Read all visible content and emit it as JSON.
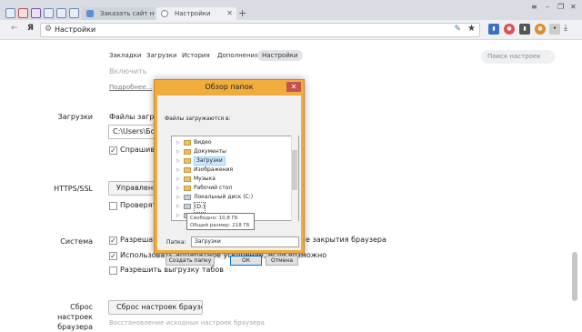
{
  "tabs": [
    {
      "label": "Заказать сайт недорого",
      "active": false
    },
    {
      "label": "Настройки",
      "active": true
    }
  ],
  "new_tab": "+",
  "window_controls": {
    "minimize": "–",
    "restore": "❐",
    "close": "✕"
  },
  "address_bar": {
    "brand": "Я",
    "url": "Настройки"
  },
  "settings_nav": [
    "Закладки",
    "Загрузки",
    "История",
    "Дополнения",
    "Настройки"
  ],
  "search_placeholder": "Поиск настроек",
  "settings": {
    "top_partial_text": "Включить",
    "more_link": "Подробнее...",
    "downloads": {
      "label": "Загрузки",
      "save_to": "Файлы загруж",
      "path": "C:\\Users\\Бос",
      "ask_checkbox": "Спрашиват"
    },
    "https": {
      "label": "HTTPS/SSL",
      "manage_button": "Управление",
      "check_checkbox": "Проверять"
    },
    "system": {
      "label": "Система",
      "item1": "Разрешать",
      "item1_tail": "е закрытия браузера",
      "item2": "Использовать аппаратное ускорение, если возможно",
      "item3": "Разрешить выгрузку табов"
    },
    "reset": {
      "label": "Сброс настроек браузера",
      "button": "Сброс настроек браузера",
      "faded": "Восстановление исходных настроек браузера"
    }
  },
  "dialog": {
    "title": "Обзор папок",
    "close": "✕",
    "caption": "Файлы загружаются в:",
    "tree": [
      {
        "name": "Видео",
        "type": "folder"
      },
      {
        "name": "Документы",
        "type": "folder"
      },
      {
        "name": "Загрузки",
        "type": "folder",
        "selected": true
      },
      {
        "name": "Изображения",
        "type": "folder"
      },
      {
        "name": "Музыка",
        "type": "folder"
      },
      {
        "name": "Рабочий стол",
        "type": "folder"
      },
      {
        "name": "Локальный диск (C:)",
        "type": "drive"
      },
      {
        "name": "(D:)",
        "type": "drive"
      },
      {
        "name": "",
        "type": "drive"
      }
    ],
    "tooltip": [
      "Свободно: 10,8 ГБ",
      "Общий размер: 218 ГБ"
    ],
    "folder_label": "Папка:",
    "folder_value": "Загрузки",
    "buttons": {
      "create": "Создать папку",
      "ok": "ОК",
      "cancel": "Отмена"
    }
  }
}
